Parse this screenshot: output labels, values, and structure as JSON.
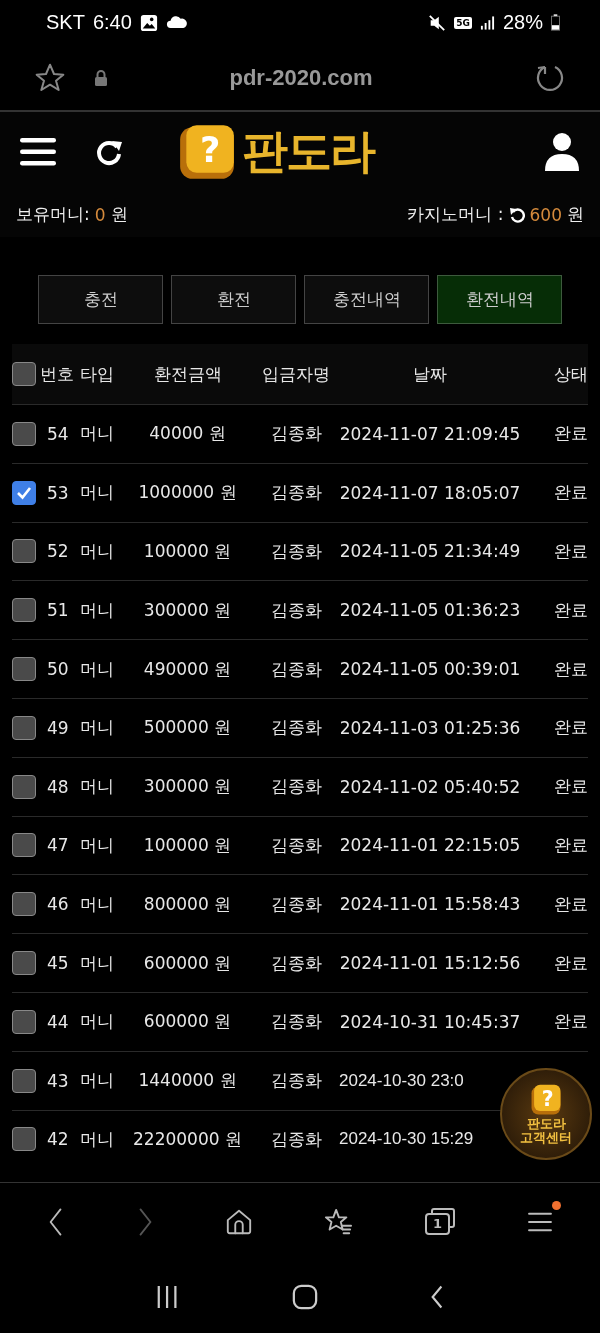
{
  "status_bar": {
    "carrier": "SKT",
    "time": "6:40",
    "network": "5G",
    "battery": "28%"
  },
  "address_bar": {
    "url": "pdr-2020.com"
  },
  "header": {
    "logo_mark": "?",
    "logo_text": "판도라"
  },
  "balance": {
    "holding_label": "보유머니:",
    "holding_value": "0",
    "holding_unit": "원",
    "casino_label": "카지노머니 :",
    "casino_value": "600",
    "casino_unit": "원"
  },
  "tabs": [
    {
      "label": "충전",
      "selected": false
    },
    {
      "label": "환전",
      "selected": false
    },
    {
      "label": "충전내역",
      "selected": false
    },
    {
      "label": "환전내역",
      "selected": true
    }
  ],
  "table": {
    "select_all_checked": false,
    "columns": [
      "번호",
      "타입",
      "환전금액",
      "입금자명",
      "날짜",
      "상태"
    ],
    "rows": [
      {
        "checked": false,
        "number": "54",
        "type": "머니",
        "amount": "40000 원",
        "name": "김종화",
        "date": "2024-11-07 21:09:45",
        "status": "완료"
      },
      {
        "checked": true,
        "number": "53",
        "type": "머니",
        "amount": "1000000 원",
        "name": "김종화",
        "date": "2024-11-07 18:05:07",
        "status": "완료"
      },
      {
        "checked": false,
        "number": "52",
        "type": "머니",
        "amount": "100000 원",
        "name": "김종화",
        "date": "2024-11-05 21:34:49",
        "status": "완료"
      },
      {
        "checked": false,
        "number": "51",
        "type": "머니",
        "amount": "300000 원",
        "name": "김종화",
        "date": "2024-11-05 01:36:23",
        "status": "완료"
      },
      {
        "checked": false,
        "number": "50",
        "type": "머니",
        "amount": "490000 원",
        "name": "김종화",
        "date": "2024-11-05 00:39:01",
        "status": "완료"
      },
      {
        "checked": false,
        "number": "49",
        "type": "머니",
        "amount": "500000 원",
        "name": "김종화",
        "date": "2024-11-03 01:25:36",
        "status": "완료"
      },
      {
        "checked": false,
        "number": "48",
        "type": "머니",
        "amount": "300000 원",
        "name": "김종화",
        "date": "2024-11-02 05:40:52",
        "status": "완료"
      },
      {
        "checked": false,
        "number": "47",
        "type": "머니",
        "amount": "100000 원",
        "name": "김종화",
        "date": "2024-11-01 22:15:05",
        "status": "완료"
      },
      {
        "checked": false,
        "number": "46",
        "type": "머니",
        "amount": "800000 원",
        "name": "김종화",
        "date": "2024-11-01 15:58:43",
        "status": "완료"
      },
      {
        "checked": false,
        "number": "45",
        "type": "머니",
        "amount": "600000 원",
        "name": "김종화",
        "date": "2024-11-01 15:12:56",
        "status": "완료"
      },
      {
        "checked": false,
        "number": "44",
        "type": "머니",
        "amount": "600000 원",
        "name": "김종화",
        "date": "2024-10-31 10:45:37",
        "status": "완료"
      },
      {
        "checked": false,
        "number": "43",
        "type": "머니",
        "amount": "1440000 원",
        "name": "김종화",
        "date": "2024-10-30 23:0"
      },
      {
        "checked": false,
        "number": "42",
        "type": "머니",
        "amount": "22200000 원",
        "name": "김종화",
        "date": "2024-10-30 15:29"
      }
    ]
  },
  "support_badge": {
    "mark": "?",
    "lines": [
      "판도라",
      "고객센터"
    ]
  },
  "browser_toolbar": {
    "tab_count": "1",
    "menu_notification": true
  }
}
